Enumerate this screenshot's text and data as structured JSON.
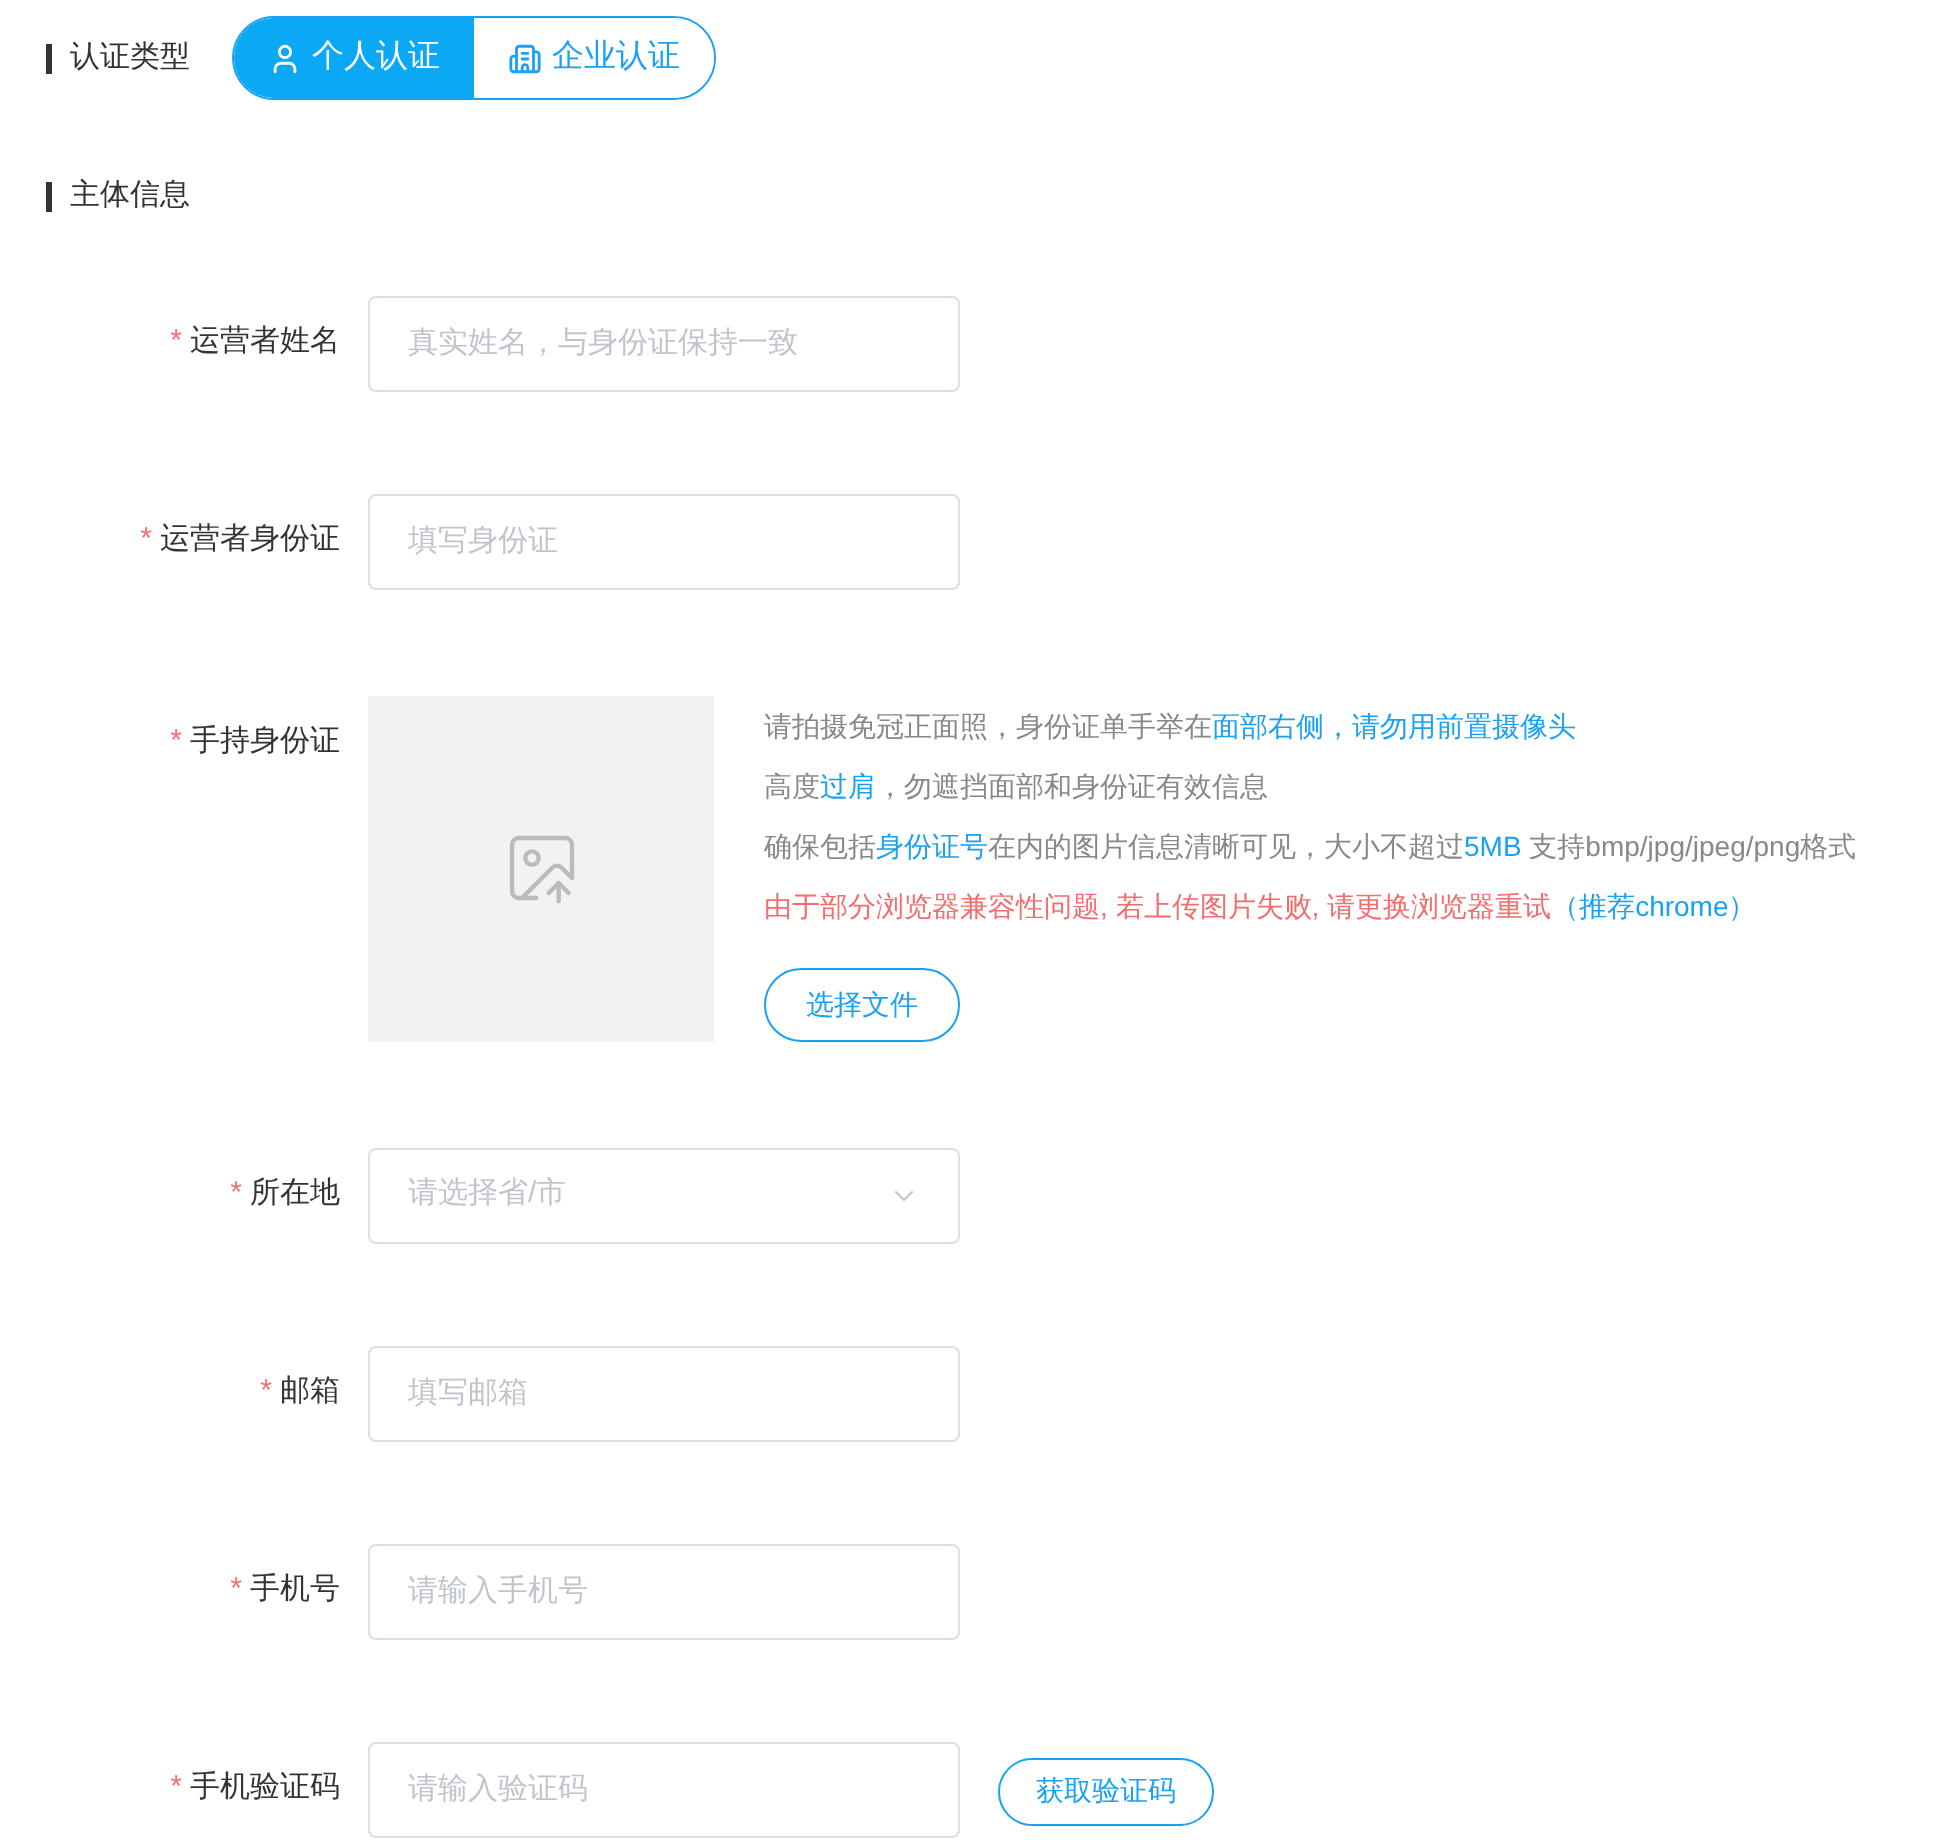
{
  "auth_type": {
    "label": "认证类型",
    "options": [
      {
        "label": "个人认证",
        "selected": true
      },
      {
        "label": "企业认证",
        "selected": false
      }
    ]
  },
  "section": {
    "title": "主体信息"
  },
  "fields": [
    {
      "kind": "text",
      "required_mark": "*",
      "label": "运营者姓名",
      "placeholder": "真实姓名，与身份证保持一致"
    },
    {
      "kind": "text",
      "required_mark": "*",
      "label": "运营者身份证",
      "placeholder": "填写身份证"
    },
    {
      "kind": "upload",
      "required_mark": "*",
      "label": "手持身份证",
      "hints": [
        [
          {
            "text": "请拍摄免冠正面照，身份证单手举在",
            "kind": "plain"
          },
          {
            "text": "面部右侧，请勿用前置摄像头",
            "kind": "highlight"
          }
        ],
        [
          {
            "text": "高度",
            "kind": "plain"
          },
          {
            "text": "过肩",
            "kind": "highlight"
          },
          {
            "text": "，勿遮挡面部和身份证有效信息",
            "kind": "plain"
          }
        ],
        [
          {
            "text": "确保包括",
            "kind": "plain"
          },
          {
            "text": "身份证号",
            "kind": "highlight"
          },
          {
            "text": "在内的图片信息清晰可见，大小不超过",
            "kind": "plain"
          },
          {
            "text": "5MB",
            "kind": "highlight"
          },
          {
            "text": " 支持bmp/jpg/jpeg/png格式",
            "kind": "plain"
          }
        ],
        [
          {
            "text": "由于部分浏览器兼容性问题, 若上传图片失败, 请更换浏览器重试",
            "kind": "warning"
          },
          {
            "text": "（推荐chrome）",
            "kind": "highlight"
          }
        ]
      ],
      "button": "选择文件"
    },
    {
      "kind": "select",
      "required_mark": "*",
      "label": "所在地",
      "placeholder": "请选择省/市"
    },
    {
      "kind": "text",
      "required_mark": "*",
      "label": "邮箱",
      "placeholder": "填写邮箱"
    },
    {
      "kind": "text",
      "required_mark": "*",
      "label": "手机号",
      "placeholder": "请输入手机号"
    },
    {
      "kind": "code",
      "required_mark": "*",
      "label": "手机验证码",
      "placeholder": "请输入验证码",
      "button": "获取验证码"
    }
  ]
}
